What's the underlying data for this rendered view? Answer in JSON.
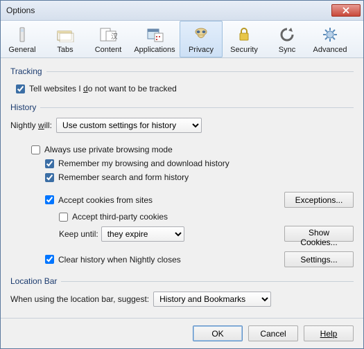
{
  "window": {
    "title": "Options"
  },
  "toolbar": {
    "general": "General",
    "tabs": "Tabs",
    "content": "Content",
    "applications": "Applications",
    "privacy": "Privacy",
    "security": "Security",
    "sync": "Sync",
    "advanced": "Advanced",
    "active": "privacy"
  },
  "tracking": {
    "legend": "Tracking",
    "donottrack_pre": "Tell websites I ",
    "donottrack_key": "d",
    "donottrack_post": "o not want to be tracked",
    "donottrack_checked": true
  },
  "history": {
    "legend": "History",
    "nightly_will_pre": "Nightly ",
    "nightly_will_key": "w",
    "nightly_will_post": "ill:",
    "mode_value": "Use custom settings for history",
    "private_mode_label": "Always use private browsing mode",
    "private_mode_checked": false,
    "remember_browsing_label": "Remember my browsing and download history",
    "remember_browsing_checked": true,
    "remember_search_label": "Remember search and form history",
    "remember_search_checked": true,
    "accept_cookies_label": "Accept cookies from sites",
    "accept_cookies_checked": true,
    "exceptions_btn": "Exceptions...",
    "third_party_label": "Accept third-party cookies",
    "third_party_checked": false,
    "keep_until_label": "Keep until:",
    "keep_until_value": "they expire",
    "show_cookies_btn": "Show Cookies...",
    "clear_on_close_label": "Clear history when Nightly closes",
    "clear_on_close_checked": true,
    "settings_btn": "Settings..."
  },
  "locationbar": {
    "legend": "Location Bar",
    "suggest_label": "When using the location bar, suggest:",
    "suggest_value": "History and Bookmarks"
  },
  "footer": {
    "ok": "OK",
    "cancel": "Cancel",
    "help": "Help"
  }
}
